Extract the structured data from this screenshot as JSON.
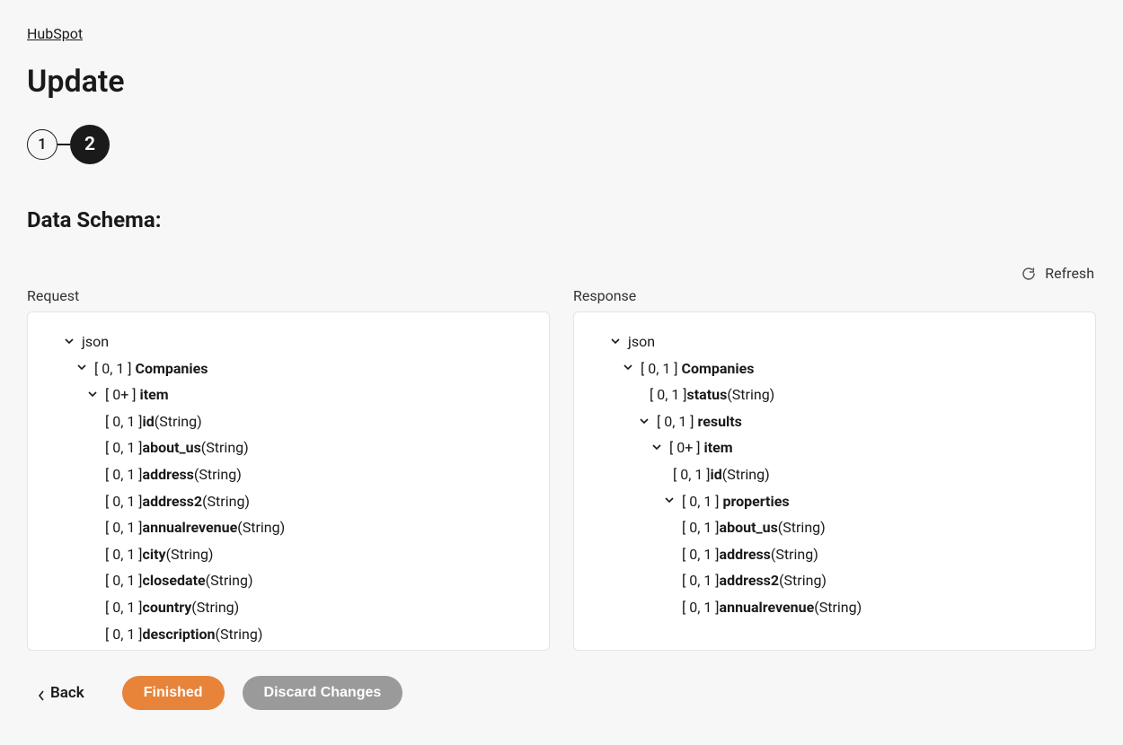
{
  "breadcrumb": "HubSpot",
  "title": "Update",
  "stepper": {
    "s1": "1",
    "s2": "2"
  },
  "section_heading": "Data Schema:",
  "refresh_label": "Refresh",
  "request_label": "Request",
  "response_label": "Response",
  "req": {
    "root": "json",
    "companies_card": "[ 0, 1 ]",
    "companies_name": "Companies",
    "item_card": "[ 0+ ]",
    "item_name": "item",
    "fields": [
      {
        "card": "[ 0, 1 ] ",
        "name": "id",
        "type": " (String)"
      },
      {
        "card": "[ 0, 1 ] ",
        "name": "about_us",
        "type": " (String)"
      },
      {
        "card": "[ 0, 1 ] ",
        "name": "address",
        "type": " (String)"
      },
      {
        "card": "[ 0, 1 ] ",
        "name": "address2",
        "type": " (String)"
      },
      {
        "card": "[ 0, 1 ] ",
        "name": "annualrevenue",
        "type": " (String)"
      },
      {
        "card": "[ 0, 1 ] ",
        "name": "city",
        "type": " (String)"
      },
      {
        "card": "[ 0, 1 ] ",
        "name": "closedate",
        "type": " (String)"
      },
      {
        "card": "[ 0, 1 ] ",
        "name": "country",
        "type": " (String)"
      },
      {
        "card": "[ 0, 1 ] ",
        "name": "description",
        "type": " (String)"
      }
    ]
  },
  "res": {
    "root": "json",
    "companies_card": "[ 0, 1 ]",
    "companies_name": "Companies",
    "status_card": "[ 0, 1 ] ",
    "status_name": "status",
    "status_type": " (String)",
    "results_card": "[ 0, 1 ]",
    "results_name": "results",
    "item_card": "[ 0+ ]",
    "item_name": "item",
    "id_card": "[ 0, 1 ] ",
    "id_name": "id",
    "id_type": " (String)",
    "props_card": "[ 0, 1 ]",
    "props_name": "properties",
    "pfields": [
      {
        "card": "[ 0, 1 ] ",
        "name": "about_us",
        "type": " (String)"
      },
      {
        "card": "[ 0, 1 ] ",
        "name": "address",
        "type": " (String)"
      },
      {
        "card": "[ 0, 1 ] ",
        "name": "address2",
        "type": " (String)"
      },
      {
        "card": "[ 0, 1 ] ",
        "name": "annualrevenue",
        "type": " (String)"
      }
    ]
  },
  "footer": {
    "back": "Back",
    "finished": "Finished",
    "discard": "Discard Changes"
  }
}
